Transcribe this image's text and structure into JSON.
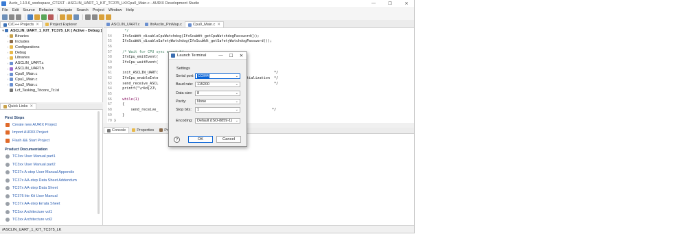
{
  "window": {
    "title": "Aurix_1.10.6_workspace_CTEST - ASCLIN_UART_1_KIT_TC375_LK/Cpu0_Main.c - AURIX Development Studio",
    "controls": [
      "—",
      "❐",
      "✕"
    ]
  },
  "menu": [
    "File",
    "Edit",
    "Source",
    "Refactor",
    "Navigate",
    "Search",
    "Project",
    "Window",
    "Help"
  ],
  "left_tabs": [
    {
      "label": "C/C++ Projects",
      "active": true,
      "closable": true
    },
    {
      "label": "Project Explorer",
      "active": false,
      "closable": false
    }
  ],
  "tree": [
    {
      "label": "ASCLIN_UART_1_KIT_TC375_LK [ Active - Debug ]",
      "icon": "project-icon",
      "expander": "▾"
    },
    {
      "label": "Binaries",
      "icon": "binaries-icon",
      "expander": "›"
    },
    {
      "label": "Includes",
      "icon": "includes-icon",
      "expander": "›"
    },
    {
      "label": "Configurations",
      "icon": "folder-icon",
      "expander": "›"
    },
    {
      "label": "Debug",
      "icon": "folder-icon",
      "expander": "›"
    },
    {
      "label": "Libraries",
      "icon": "folder-icon",
      "expander": "›"
    },
    {
      "label": "ASCLIN_UART.c",
      "icon": "c-file-icon",
      "expander": "›"
    },
    {
      "label": "ASCLIN_UART.h",
      "icon": "h-file-icon",
      "expander": "›"
    },
    {
      "label": "Cpu0_Main.c",
      "icon": "c-file-icon",
      "expander": "›"
    },
    {
      "label": "Cpu1_Main.c",
      "icon": "c-file-icon",
      "expander": "›"
    },
    {
      "label": "Cpu2_Main.c",
      "icon": "c-file-icon",
      "expander": "›"
    },
    {
      "label": "Lcf_Tasking_Tricore_Tc.lsl",
      "icon": "lsl-file-icon",
      "expander": ""
    }
  ],
  "quick_links": {
    "tab": "Quick Links",
    "first_steps_heading": "First Steps",
    "first_steps": [
      "Create new AURIX Project",
      "Import AURIX Project",
      "Flash && Start Project"
    ],
    "docs_heading": "Product Documentation",
    "docs": [
      "TC3xx User Manual part1",
      "TC3xx User Manual part2",
      "TC37x A-step User Manual Appendix",
      "TC37x AA-step Data Sheet Addendum",
      "TC37x AA-step Data Sheet",
      "TC375 lite Kit User Manual",
      "TC37x AA-step Errata Sheet",
      "TC3xx Architecture vol1",
      "TC3xx Architecture vol2"
    ]
  },
  "editor_tabs": [
    {
      "label": "ASCLIN_UART.c",
      "active": false
    },
    {
      "label": "IfxAsclin_PinMap.c",
      "active": false
    },
    {
      "label": "Cpu0_Main.c",
      "active": true
    }
  ],
  "code": [
    {
      "ln": "",
      "text": "     */",
      "cls": "comment"
    },
    {
      "ln": "54",
      "text": "    IfxScuWdt_disableCpuWatchdog(IfxScuWdt_getCpuWatchdogPassword());",
      "cls": ""
    },
    {
      "ln": "55",
      "text": "    IfxScuWdt_disableSafetyWatchdog(IfxScuWdt_getSafetyWatchdogPassword());",
      "cls": ""
    },
    {
      "ln": "56",
      "text": "",
      "cls": ""
    },
    {
      "ln": "57",
      "text": "    /* Wait for CPU sync event */",
      "cls": "comment"
    },
    {
      "ln": "58",
      "text": "    IfxCpu_emitEvent(",
      "cls": ""
    },
    {
      "ln": "59",
      "text": "    IfxCpu_waitEvent(",
      "cls": ""
    },
    {
      "ln": "60",
      "text": "",
      "cls": ""
    },
    {
      "ln": "61",
      "text": "    init_ASCLIN_UART(                          the module                   */",
      "cls": ""
    },
    {
      "ln": "62",
      "text": "    IfxCpu_enableInte                          rrupts after initialization  */",
      "cls": ""
    },
    {
      "ln": "63",
      "text": "    send_receive_ASCL                          ring                         */",
      "cls": ""
    },
    {
      "ln": "64",
      "text": "    printf(\"\\n%d[2J\\",
      "cls": ""
    },
    {
      "ln": "65",
      "text": "",
      "cls": ""
    },
    {
      "ln": "66",
      "text": "    while(1)",
      "cls": "kw"
    },
    {
      "ln": "67",
      "text": "    {",
      "cls": ""
    },
    {
      "ln": "68",
      "text": "        send_receive_                          e string                    */",
      "cls": ""
    },
    {
      "ln": "69",
      "text": "    }",
      "cls": ""
    },
    {
      "ln": "70",
      "text": "}",
      "cls": ""
    },
    {
      "ln": "71",
      "text": "",
      "cls": ""
    }
  ],
  "bottom_tabs": [
    {
      "label": "Console",
      "active": true
    },
    {
      "label": "Properties",
      "active": false
    },
    {
      "label": "Probl",
      "active": false
    }
  ],
  "status": "/ASCLIN_UART_1_KIT_TC375_LK",
  "dialog": {
    "title": "Launch Terminal",
    "settings_label": "Settings",
    "fields": [
      {
        "label": "Serial port:",
        "value": "COM4",
        "selected": true
      },
      {
        "label": "Baud rate:",
        "value": "115200",
        "selected": false
      },
      {
        "label": "Data size:",
        "value": "8",
        "selected": false
      },
      {
        "label": "Parity:",
        "value": "None",
        "selected": false
      },
      {
        "label": "Stop bits:",
        "value": "1",
        "selected": false
      }
    ],
    "encoding": {
      "label": "Encoding:",
      "value": "Default (ISO-8859-1)"
    },
    "ok_label": "OK",
    "cancel_label": "Cancel",
    "help_label": "?"
  }
}
